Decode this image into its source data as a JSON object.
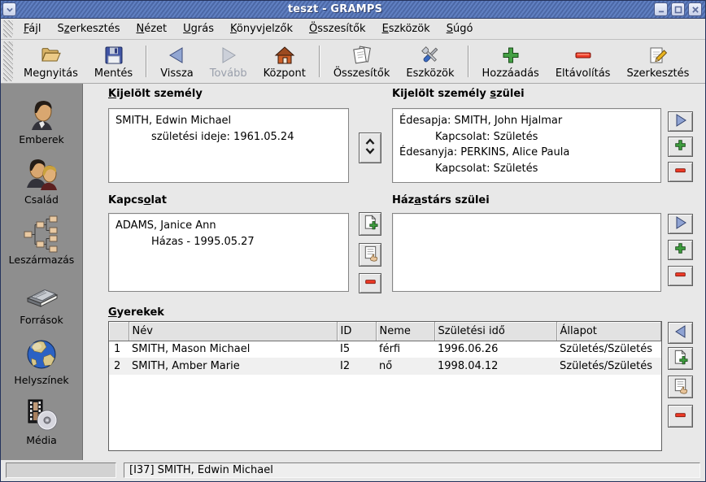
{
  "window": {
    "title": "teszt - GRAMPS"
  },
  "colors": {
    "titlebar_blue": "#4c68a6",
    "sidebar_gray": "#8e8e8e",
    "add_green": "#3e9e3e",
    "remove_red": "#ee3a26",
    "nav_arrow_blue": "#8fa3d3",
    "disabled_text": "#9aa0ac",
    "list_bg": "#ffffff"
  },
  "icons": {
    "window_menu": "chevron-down",
    "minimize": "minus",
    "maximize": "square-outline",
    "close": "x-cross",
    "open": "open-folder",
    "save": "floppy-disk",
    "back": "left-triangle-arrow",
    "forward": "right-triangle-arrow",
    "home": "house",
    "reports": "stacked-papers",
    "tools": "crossed-tools",
    "add": "green-plus",
    "remove": "red-minus",
    "edit": "pencil-on-paper",
    "people": "person-head",
    "family": "two-heads",
    "pedigree": "tree-boxes",
    "sources": "book",
    "places": "globe",
    "media": "filmstrip-cd",
    "swap": "up-down-chevrons",
    "goto_right": "blue-right-arrow",
    "goto_left": "blue-left-arrow",
    "add_record": "document-plus",
    "select_record": "document-hand"
  },
  "menu": {
    "items": [
      {
        "label": "Fájl",
        "m": 0
      },
      {
        "label": "Szerkesztés",
        "m": 1
      },
      {
        "label": "Nézet",
        "m": 0
      },
      {
        "label": "Ugrás",
        "m": 0
      },
      {
        "label": "Könyvjelzők",
        "m": 0
      },
      {
        "label": "Összesítők",
        "m": 0
      },
      {
        "label": "Eszközök",
        "m": 0
      },
      {
        "label": "Súgó",
        "m": 0
      }
    ]
  },
  "toolbar": {
    "buttons": [
      {
        "label": "Megnyitás"
      },
      {
        "label": "Mentés"
      },
      {
        "label": "Vissza"
      },
      {
        "label": "Tovább",
        "disabled": true
      },
      {
        "label": "Központ"
      },
      {
        "label": "Összesítők"
      },
      {
        "label": "Eszközök"
      },
      {
        "label": "Hozzáadás"
      },
      {
        "label": "Eltávolítás"
      },
      {
        "label": "Szerkesztés"
      }
    ]
  },
  "sidebar": {
    "items": [
      {
        "label": "Emberek"
      },
      {
        "label": "Család"
      },
      {
        "label": "Leszármazás"
      },
      {
        "label": "Források"
      },
      {
        "label": "Helyszínek"
      },
      {
        "label": "Média"
      }
    ]
  },
  "sections": {
    "active": {
      "label": "Kijelölt személy",
      "m": 0,
      "name": "SMITH, Edwin Michael",
      "birth": "születési ideje: 1961.05.24"
    },
    "parents": {
      "label": "Kijelölt személy szülei",
      "m": 17,
      "father": "Édesapja: SMITH, John Hjalmar",
      "father_rel": "Kapcsolat: Születés",
      "mother": "Édesanyja: PERKINS, Alice Paula",
      "mother_rel": "Kapcsolat: Születés"
    },
    "relation": {
      "label": "Kapcsolat",
      "m": 5,
      "spouse": "ADAMS, Janice Ann",
      "rel": "Házas - 1995.05.27"
    },
    "spouse_parents": {
      "label": "Házastárs szülei",
      "m": 3
    }
  },
  "children": {
    "label": "Gyerekek",
    "m": 0,
    "headers": [
      "",
      "Név",
      "ID",
      "Neme",
      "Születési idő",
      "Állapot"
    ],
    "rows": [
      {
        "num": "1",
        "name": "SMITH, Mason Michael",
        "id": "I5",
        "gender": "férfi",
        "birth": "1996.06.26",
        "status": "Születés/Születés"
      },
      {
        "num": "2",
        "name": "SMITH, Amber Marie",
        "id": "I2",
        "gender": "nő",
        "birth": "1998.04.12",
        "status": "Születés/Születés"
      }
    ]
  },
  "statusbar": {
    "text": "[I37] SMITH, Edwin Michael"
  }
}
